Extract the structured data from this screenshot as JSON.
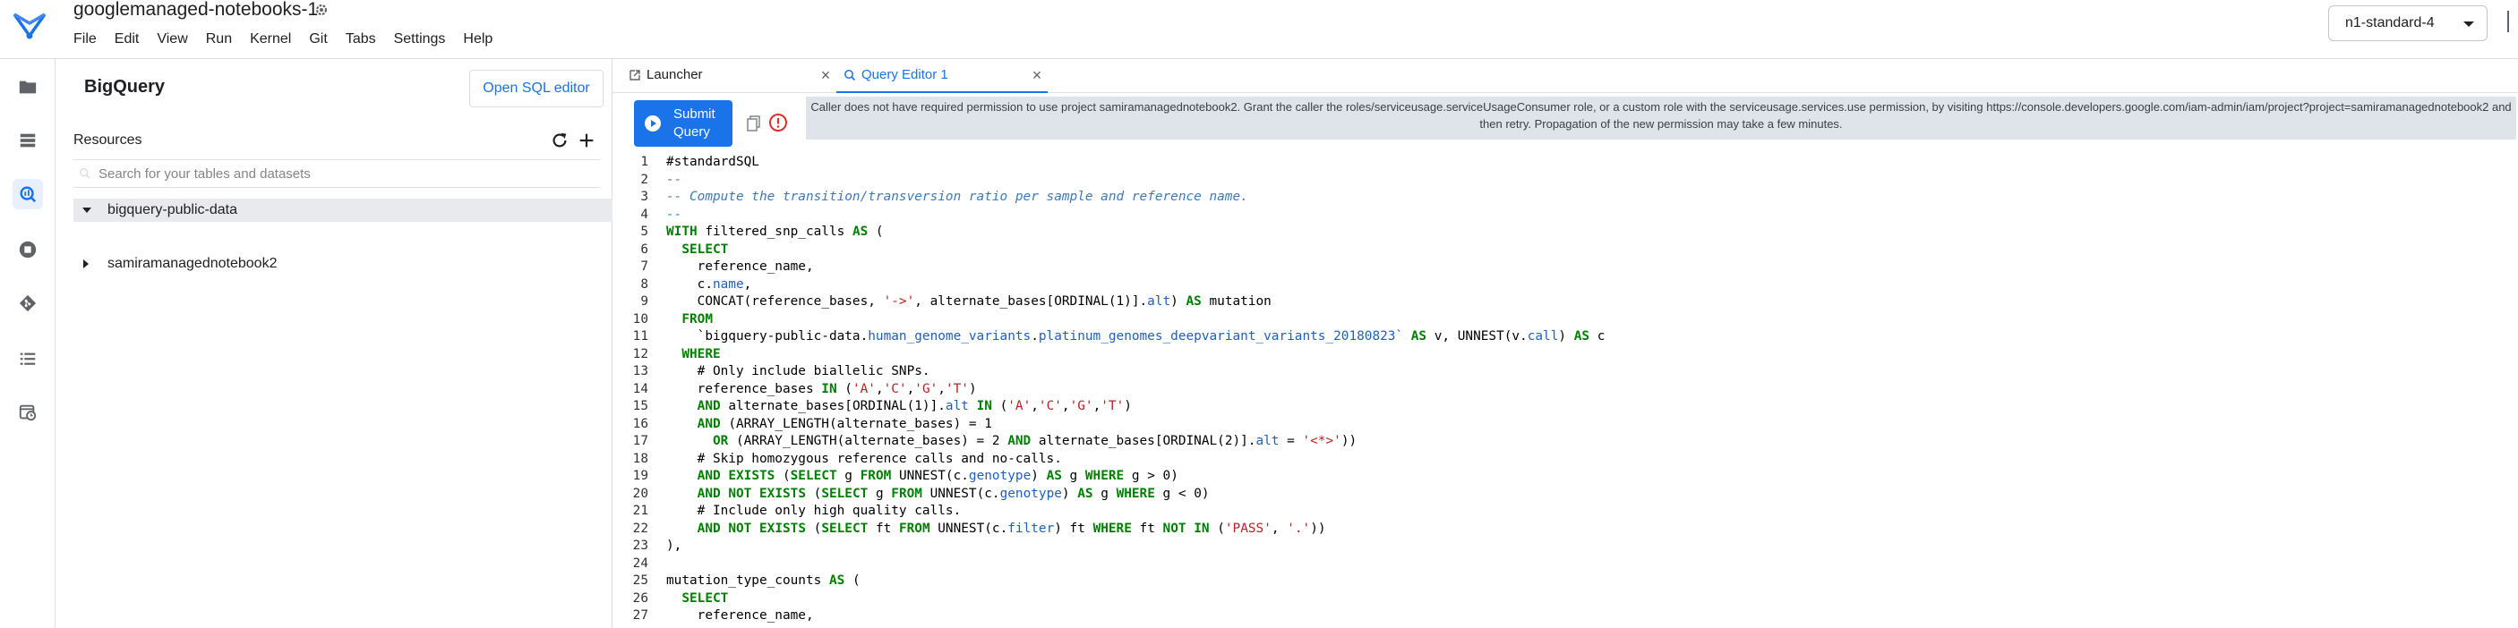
{
  "header": {
    "title": "googlemanaged-notebooks-1",
    "menu": [
      "File",
      "Edit",
      "View",
      "Run",
      "Kernel",
      "Git",
      "Tabs",
      "Settings",
      "Help"
    ],
    "machine_type": "n1-standard-4"
  },
  "rail": {
    "icons": [
      "folder-icon",
      "list-icon",
      "bigquery-icon",
      "stop-circle-icon",
      "git-icon",
      "toc-icon",
      "schedule-icon"
    ],
    "active": "bigquery-icon"
  },
  "panel": {
    "title": "BigQuery",
    "open_sql_editor": "Open SQL editor",
    "resources_label": "Resources",
    "search_placeholder": "Search for your tables and datasets",
    "tree": [
      {
        "label": "bigquery-public-data",
        "expanded": true,
        "selected": true
      },
      {
        "label": "samiramanagednotebook2",
        "expanded": false,
        "selected": false
      }
    ]
  },
  "tabs": [
    {
      "label": "Launcher",
      "active": false,
      "icon": "launcher-icon"
    },
    {
      "label": "Query Editor 1",
      "active": true,
      "icon": "query-editor-icon"
    }
  ],
  "toolbar": {
    "submit_label_1": "Submit",
    "submit_label_2": "Query",
    "error_message": "Caller does not have required permission to use project samiramanagednotebook2. Grant the caller the roles/serviceusage.serviceUsageConsumer role, or a custom role with the serviceusage.services.use permission, by visiting https://console.developers.google.com/iam-admin/iam/project?project=samiramanagednotebook2 and then retry. Propagation of the new permission may take a few minutes."
  },
  "colors": {
    "accent": "#1a73e8",
    "keyword": "#008000",
    "comment": "#3d7ab8",
    "string": "#ba2121",
    "error_bg": "#dfe3ea",
    "error_icon": "#d93025"
  },
  "code_lines": [
    "#standardSQL",
    "--",
    "-- Compute the transition/transversion ratio per sample and reference name.",
    "--",
    "WITH filtered_snp_calls AS (",
    "  SELECT",
    "    reference_name,",
    "    c.name,",
    "    CONCAT(reference_bases, '->', alternate_bases[ORDINAL(1)].alt) AS mutation",
    "  FROM",
    "    `bigquery-public-data.human_genome_variants.platinum_genomes_deepvariant_variants_20180823` AS v, UNNEST(v.call) AS c",
    "  WHERE",
    "    # Only include biallelic SNPs.",
    "    reference_bases IN ('A','C','G','T')",
    "    AND alternate_bases[ORDINAL(1)].alt IN ('A','C','G','T')",
    "    AND (ARRAY_LENGTH(alternate_bases) = 1",
    "      OR (ARRAY_LENGTH(alternate_bases) = 2 AND alternate_bases[ORDINAL(2)].alt = '<*>'))",
    "    # Skip homozygous reference calls and no-calls.",
    "    AND EXISTS (SELECT g FROM UNNEST(c.genotype) AS g WHERE g > 0)",
    "    AND NOT EXISTS (SELECT g FROM UNNEST(c.genotype) AS g WHERE g < 0)",
    "    # Include only high quality calls.",
    "    AND NOT EXISTS (SELECT ft FROM UNNEST(c.filter) ft WHERE ft NOT IN ('PASS', '.'))",
    "),",
    "",
    "mutation_type_counts AS (",
    "  SELECT",
    "    reference_name,"
  ]
}
